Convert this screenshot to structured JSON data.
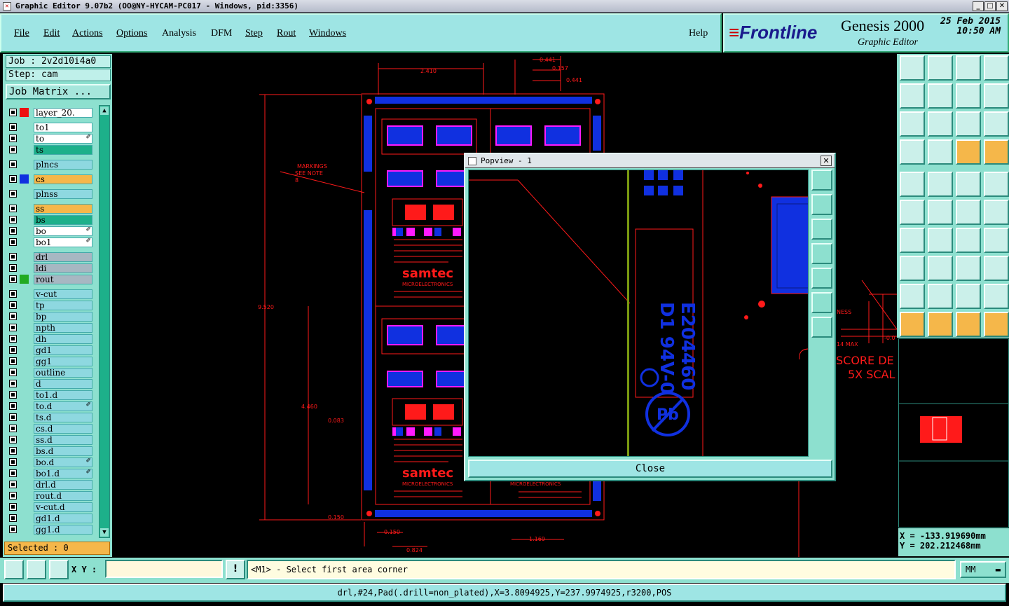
{
  "window": {
    "title": "Graphic Editor 9.07b2 (OO@NY-HYCAM-PC017 - Windows, pid:3356)"
  },
  "menu": [
    {
      "label": "File"
    },
    {
      "label": "Edit"
    },
    {
      "label": "Actions"
    },
    {
      "label": "Options"
    },
    {
      "label": "Analysis"
    },
    {
      "label": "DFM"
    },
    {
      "label": "Step"
    },
    {
      "label": "Rout"
    },
    {
      "label": "Windows"
    }
  ],
  "help_label": "Help",
  "brand": {
    "logo": "Frontline",
    "product": "Genesis 2000",
    "subtitle": "Graphic Editor",
    "date": "25 Feb 2015",
    "time": "10:50 AM"
  },
  "job": {
    "job_label": "Job : 2v2d10i4a0",
    "step_label": "Step: cam",
    "matrix_button": "Job Matrix ..."
  },
  "layers": [
    {
      "name": "layer_20.",
      "style": "w",
      "swatch": "#e11"
    },
    {
      "name": "to1",
      "style": "w"
    },
    {
      "name": "to",
      "style": "w",
      "mark": "✐"
    },
    {
      "name": "ts",
      "style": "g"
    },
    {
      "name": "plncs",
      "style": "lb"
    },
    {
      "name": "cs",
      "style": "o",
      "swatch": "#1030e0"
    },
    {
      "name": "plnss",
      "style": "lb"
    },
    {
      "name": "ss",
      "style": "o"
    },
    {
      "name": "bs",
      "style": "g"
    },
    {
      "name": "bo",
      "style": "w",
      "mark": "✐"
    },
    {
      "name": "bo1",
      "style": "w",
      "mark": "✐"
    },
    {
      "name": "drl",
      "style": "gr"
    },
    {
      "name": "ldi",
      "style": "gr"
    },
    {
      "name": "rout",
      "style": "gr",
      "swatch": "#22aa22"
    },
    {
      "name": "v-cut",
      "style": "lb"
    },
    {
      "name": "tp",
      "style": "lb"
    },
    {
      "name": "bp",
      "style": "lb"
    },
    {
      "name": "npth",
      "style": "lb"
    },
    {
      "name": "dh",
      "style": "lb"
    },
    {
      "name": "gd1",
      "style": "lb"
    },
    {
      "name": "gg1",
      "style": "lb"
    },
    {
      "name": "outline",
      "style": "lb"
    },
    {
      "name": "d",
      "style": "lb"
    },
    {
      "name": "to1.d",
      "style": "lb"
    },
    {
      "name": "to.d",
      "style": "lb",
      "mark": "✐"
    },
    {
      "name": "ts.d",
      "style": "lb"
    },
    {
      "name": "cs.d",
      "style": "lb"
    },
    {
      "name": "ss.d",
      "style": "lb"
    },
    {
      "name": "bs.d",
      "style": "lb"
    },
    {
      "name": "bo.d",
      "style": "lb",
      "mark": "✐"
    },
    {
      "name": "bo1.d",
      "style": "lb",
      "mark": "✐"
    },
    {
      "name": "drl.d",
      "style": "lb"
    },
    {
      "name": "rout.d",
      "style": "lb"
    },
    {
      "name": "v-cut.d",
      "style": "lb"
    },
    {
      "name": "gd1.d",
      "style": "lb"
    },
    {
      "name": "gg1.d",
      "style": "lb"
    }
  ],
  "selected_label": "Selected : 0",
  "canvas": {
    "dims": [
      "2.410",
      "0.441",
      "0.157",
      "0.441",
      "9.520",
      "4.460",
      "0.083",
      "0.150",
      "0.150",
      "0.824",
      "1.169"
    ],
    "markings_note": [
      "MARKINGS",
      "SEE NOTE",
      "8"
    ],
    "score_text": [
      "SCORE DE",
      "5X SCAL"
    ],
    "side_text": [
      "NESS",
      "14 MAX",
      "-0.0"
    ],
    "board_text": {
      "brand": "samtec",
      "sub": "MICROELECTRONICS"
    }
  },
  "popview": {
    "title": "Popview - 1",
    "close_label": "Close",
    "part_lines": [
      "E204460",
      "D1 94V-0",
      "Pb"
    ]
  },
  "coords": {
    "x": "X = -133.919690mm",
    "y": "Y = 202.212468mm"
  },
  "command": {
    "xy_label": "X Y :",
    "xy_value": "",
    "prompt": "<M1> - Select first area corner",
    "units": "MM"
  },
  "status_line": "drl,#24,Pad(.drill=non_plated),X=3.8094925,Y=237.9974925,r3200,POS",
  "colors": {
    "panel": "#8de0cf",
    "menubar": "#9ee5e4",
    "feature_red": "#ff1a1a",
    "feature_blue": "#1030e0",
    "feature_magenta": "#ff1aff"
  }
}
